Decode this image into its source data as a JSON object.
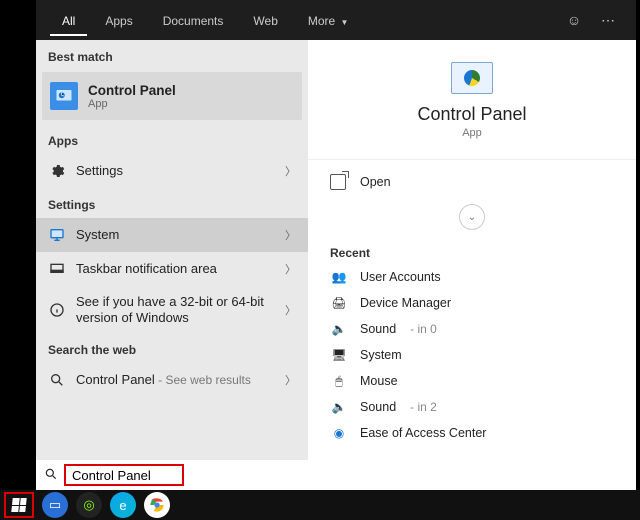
{
  "tabs": {
    "all": "All",
    "apps": "Apps",
    "documents": "Documents",
    "web": "Web",
    "more": "More"
  },
  "left": {
    "bestMatchLabel": "Best match",
    "bestMatch": {
      "title": "Control Panel",
      "sub": "App"
    },
    "appsLabel": "Apps",
    "settingsRow": "Settings",
    "settingsLabel": "Settings",
    "system": "System",
    "taskbar": "Taskbar notification area",
    "bitness": "See if you have a 32-bit or 64-bit version of Windows",
    "searchWebLabel": "Search the web",
    "webResult": {
      "main": "Control Panel",
      "suffix": " - See web results"
    }
  },
  "right": {
    "title": "Control Panel",
    "sub": "App",
    "open": "Open",
    "recentLabel": "Recent",
    "items": [
      {
        "label": "User Accounts",
        "suffix": ""
      },
      {
        "label": "Device Manager",
        "suffix": ""
      },
      {
        "label": "Sound",
        "suffix": " - in 0"
      },
      {
        "label": "System",
        "suffix": ""
      },
      {
        "label": "Mouse",
        "suffix": ""
      },
      {
        "label": "Sound",
        "suffix": " - in 2"
      },
      {
        "label": "Ease of Access Center",
        "suffix": ""
      }
    ]
  },
  "search": {
    "value": "Control Panel"
  }
}
